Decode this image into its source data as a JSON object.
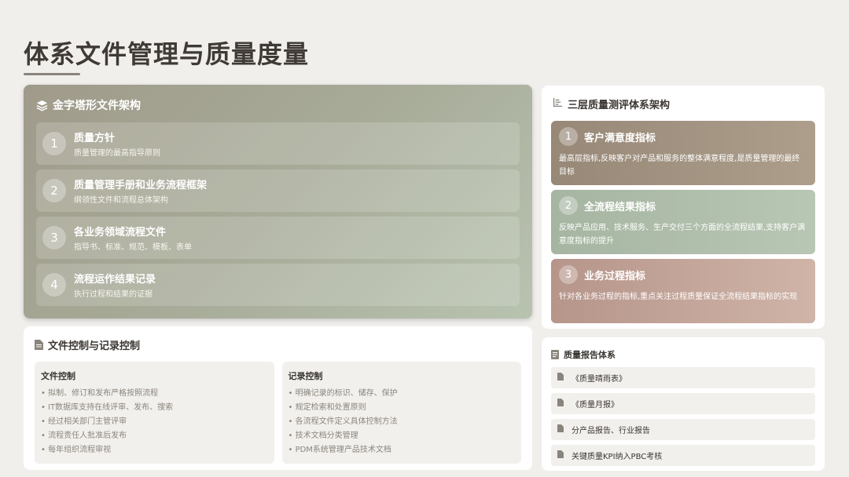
{
  "page": {
    "title": "体系文件管理与质量度量"
  },
  "pyramid": {
    "heading": "金字塔形文件架构",
    "tiers": [
      {
        "num": "1",
        "title": "质量方针",
        "subtitle": "质量管理的最高指导原则"
      },
      {
        "num": "2",
        "title": "质量管理手册和业务流程框架",
        "subtitle": "纲领性文件和流程总体架构"
      },
      {
        "num": "3",
        "title": "各业务领域流程文件",
        "subtitle": "指导书、标准、规范、模板、表单"
      },
      {
        "num": "4",
        "title": "流程运作结果记录",
        "subtitle": "执行过程和结果的证据"
      }
    ]
  },
  "metrics": {
    "heading": "三层质量测评体系架构",
    "items": [
      {
        "num": "1",
        "title": "客户满意度指标",
        "desc": "最高层指标,反映客户对产品和服务的整体满意程度,是质量管理的最终目标"
      },
      {
        "num": "2",
        "title": "全流程结果指标",
        "desc": "反映产品应用、技术服务、生产交付三个方面的全流程结果,支持客户满意度指标的提升"
      },
      {
        "num": "3",
        "title": "业务过程指标",
        "desc": "针对各业务过程的指标,重点关注过程质量保证全流程结果指标的实现"
      }
    ]
  },
  "control": {
    "heading": "文件控制与记录控制",
    "file_control": {
      "title": "文件控制",
      "items": [
        "• 拟制、修订和发布严格按照流程",
        "• IT数据库支持在线评审、发布、搜索",
        "• 经过相关部门主管评审",
        "• 流程责任人批准后发布",
        "• 每年组织流程审视"
      ]
    },
    "record_control": {
      "title": "记录控制",
      "items": [
        "• 明确记录的标识、储存、保护",
        "• 规定检索和处置原则",
        "• 各流程文件定义具体控制方法",
        "• 技术文档分类管理",
        "• PDM系统管理产品技术文档"
      ]
    }
  },
  "report": {
    "heading": "质量报告体系",
    "items": [
      "《质量晴雨表》",
      "《质量月报》",
      "分产品报告、行业报告",
      "关键质量KPI纳入PBC考核"
    ]
  },
  "colors": {
    "background": "#f1efec",
    "metric_1": "#978877",
    "metric_2": "#a6b5a1",
    "metric_3": "#b6958a"
  }
}
